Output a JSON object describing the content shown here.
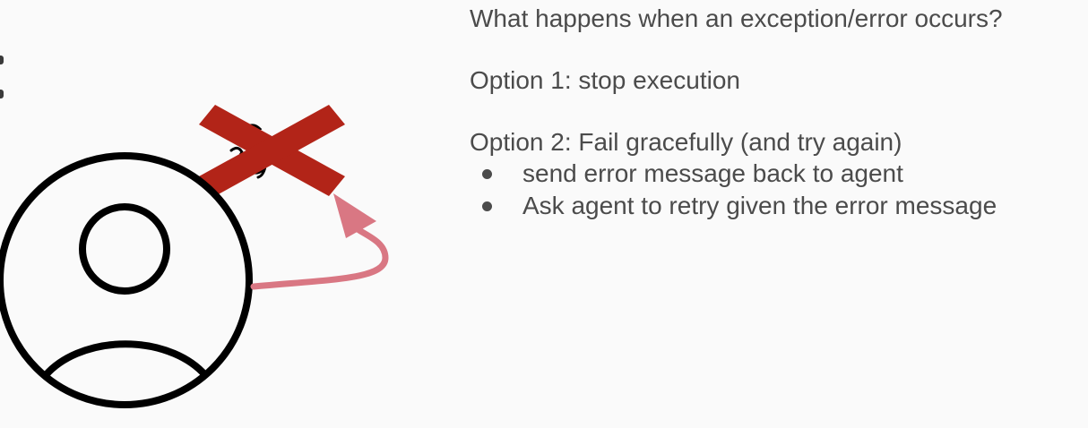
{
  "content": {
    "question": "What happens when an exception/error occurs?",
    "option_1": "Option 1: stop execution",
    "option_2": "Option 2: Fail gracefully (and try again)",
    "bullets": [
      "send error message back to agent",
      "Ask agent to retry given the error message"
    ]
  },
  "illustration": {
    "icons": [
      "user-avatar-icon",
      "tool-x-icon",
      "retry-arrow-icon"
    ],
    "colors": {
      "outline": "#000000",
      "cross": "#b22418",
      "arrow": "#d97783",
      "background": "#fafafa",
      "text": "#4b4b4b"
    }
  }
}
